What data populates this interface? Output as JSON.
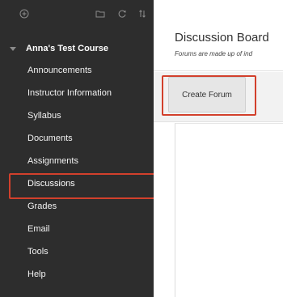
{
  "sidebar": {
    "toolbar": {
      "icons": [
        "add-icon",
        "folder-icon",
        "refresh-icon",
        "sort-icon"
      ]
    },
    "course_title": "Anna's Test Course",
    "items": [
      {
        "label": "Announcements"
      },
      {
        "label": "Instructor Information"
      },
      {
        "label": "Syllabus"
      },
      {
        "label": "Documents"
      },
      {
        "label": "Assignments"
      },
      {
        "label": "Discussions",
        "active": true
      },
      {
        "label": "Grades"
      },
      {
        "label": "Email"
      },
      {
        "label": "Tools"
      },
      {
        "label": "Help"
      }
    ]
  },
  "main": {
    "title": "Discussion Board",
    "subtitle": "Forums are made up of ind",
    "actions": {
      "create_forum_label": "Create Forum"
    }
  },
  "colors": {
    "sidebar_bg": "#2d2d2d",
    "highlight": "#d2402c",
    "action_bar_bg": "#f2f2f2"
  }
}
